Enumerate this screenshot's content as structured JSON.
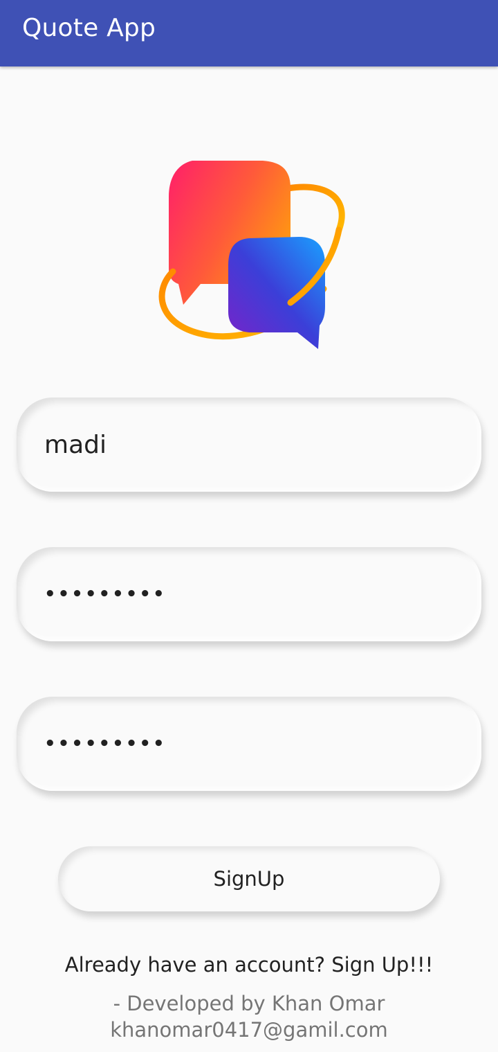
{
  "app_bar": {
    "title": "Quote App",
    "color": "#3f51b5"
  },
  "logo": {
    "icon": "chat-bubbles-logo-icon"
  },
  "form": {
    "username_value": "madi",
    "password_value": "•••••••••",
    "confirm_password_value": "•••••••••"
  },
  "signup_button": {
    "label": "SignUp"
  },
  "footer": {
    "already_account": "Already have an account? Sign Up!!!",
    "developed_by": "- Developed by Khan Omar",
    "email": "khanomar0417@gamil.com"
  }
}
